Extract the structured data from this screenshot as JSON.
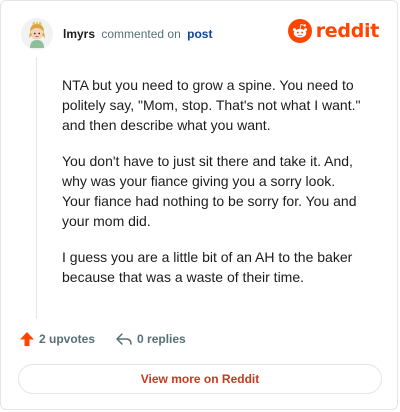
{
  "comment": {
    "author": "lmyrs",
    "action_text": "commented on",
    "post_link": "post",
    "body": [
      "NTA but you need to grow a spine. You need to politely say, \"Mom, stop. That's not what I want.\" and then describe what you want.",
      "You don't have to just sit there and take it. And, why was your fiance giving you a sorry look. Your fiance had nothing to be sorry for. You and your mom did.",
      "I guess you are a little bit of an AH to the baker because that was a waste of their time."
    ]
  },
  "brand": {
    "name": "reddit",
    "icon": "reddit-logo-icon",
    "color": "#ff4500"
  },
  "actions": {
    "upvotes": "2 upvotes",
    "upvote_icon": "upvote-arrow-icon",
    "replies": "0 replies",
    "reply_icon": "reply-arrow-icon"
  },
  "cta": {
    "label": "View more on Reddit"
  },
  "colors": {
    "upvote": "#ff4500",
    "link": "#0a449b",
    "cta_text": "#c53a1f",
    "muted": "#576f76"
  }
}
